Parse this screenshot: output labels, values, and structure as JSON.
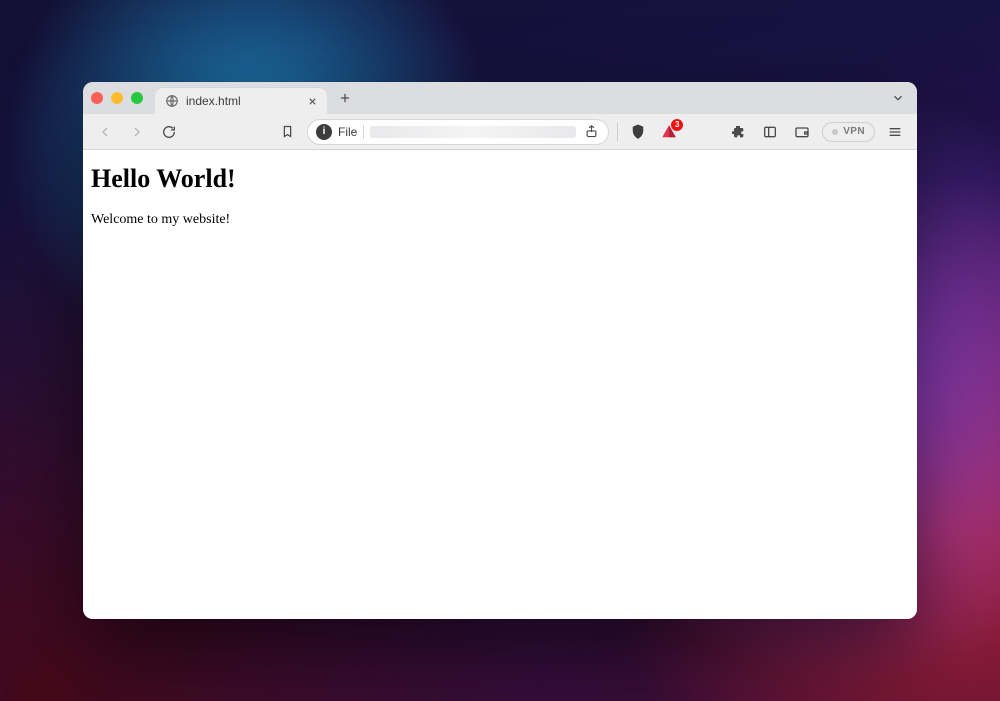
{
  "window": {
    "tab_title": "index.html"
  },
  "toolbar": {
    "scheme_label": "File",
    "vpn_label": "VPN",
    "rewards_badge_count": "3"
  },
  "page": {
    "heading": "Hello World!",
    "paragraph": "Welcome to my website!"
  }
}
